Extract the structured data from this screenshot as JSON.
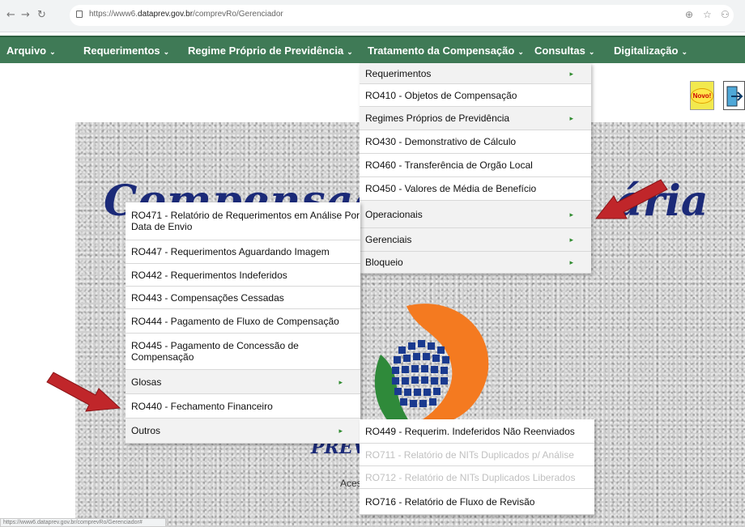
{
  "browser": {
    "url_prefix": "https://www6.",
    "url_host": "dataprev.gov.br",
    "url_path": "/comprevRo/Gerenciador",
    "back_icon": "back-arrow-icon",
    "forward_icon": "forward-arrow-icon",
    "reload_icon": "reload-icon",
    "zoom_icon": "zoom-icon",
    "star_icon": "star-icon",
    "extension_icon": "extension-icon",
    "status_url": "https://www6.dataprev.gov.br/comprevRo/Gerenciador#"
  },
  "menubar": {
    "items": [
      {
        "label": "Arquivo"
      },
      {
        "label": "Requerimentos"
      },
      {
        "label": "Regime Próprio de Previdência"
      },
      {
        "label": "Tratamento da Compensação"
      },
      {
        "label": "Consultas"
      },
      {
        "label": "Digitalização"
      }
    ],
    "caret": "⌄"
  },
  "header_buttons": {
    "novo": "Novo!"
  },
  "banner": {
    "title_left": "Compensaçã",
    "title_right": "ária",
    "footer_fragment": "PREV",
    "access_fragment": "Aces"
  },
  "menu_tratamento": {
    "items": [
      {
        "label": "Requerimentos",
        "submenu": true
      },
      {
        "label": "RO410 - Objetos de Compensação",
        "submenu": false
      },
      {
        "label": "Regimes Próprios de Previdência",
        "submenu": true
      },
      {
        "label": "RO430 - Demonstrativo de Cálculo",
        "submenu": false
      },
      {
        "label": "RO460 - Transferência de Orgão Local",
        "submenu": false
      },
      {
        "label": "RO450 - Valores de Média de Benefício",
        "submenu": false
      },
      {
        "label": "Operacionais",
        "submenu": true
      },
      {
        "label": "Gerenciais",
        "submenu": true
      },
      {
        "label": "Bloqueio",
        "submenu": true
      }
    ]
  },
  "menu_operacionais": {
    "items": [
      {
        "label": "RO471 - Relatório de Requerimentos em Análise Por Data de Envio",
        "submenu": false
      },
      {
        "label": "RO447 - Requerimentos Aguardando Imagem",
        "submenu": false
      },
      {
        "label": "RO442 - Requerimentos Indeferidos",
        "submenu": false
      },
      {
        "label": "RO443 - Compensações Cessadas",
        "submenu": false
      },
      {
        "label": "RO444 - Pagamento de Fluxo de Compensação",
        "submenu": false
      },
      {
        "label": "RO445 - Pagamento de Concessão de Compensação",
        "submenu": false
      },
      {
        "label": "Glosas",
        "submenu": true
      },
      {
        "label": "RO440 - Fechamento Financeiro",
        "submenu": false
      },
      {
        "label": "Outros",
        "submenu": true
      }
    ]
  },
  "menu_outros": {
    "items": [
      {
        "label": "RO449 - Requerim. Indeferidos Não Reenviados",
        "disabled": false
      },
      {
        "label": "RO711 - Relatório de NITs Duplicados p/ Análise",
        "disabled": true
      },
      {
        "label": "RO712 - Relatório de NITs Duplicados Liberados",
        "disabled": true
      },
      {
        "label": "RO716 - Relatório de Fluxo de Revisão",
        "disabled": false
      }
    ]
  },
  "submenu_arrow": "▸",
  "colors": {
    "menubar": "#3f7a56",
    "banner_text": "#1b2a78",
    "arrow_red": "#c0262a",
    "logo_orange": "#f47a20",
    "logo_green": "#2f8a3a",
    "logo_blue": "#1a3a8f"
  }
}
